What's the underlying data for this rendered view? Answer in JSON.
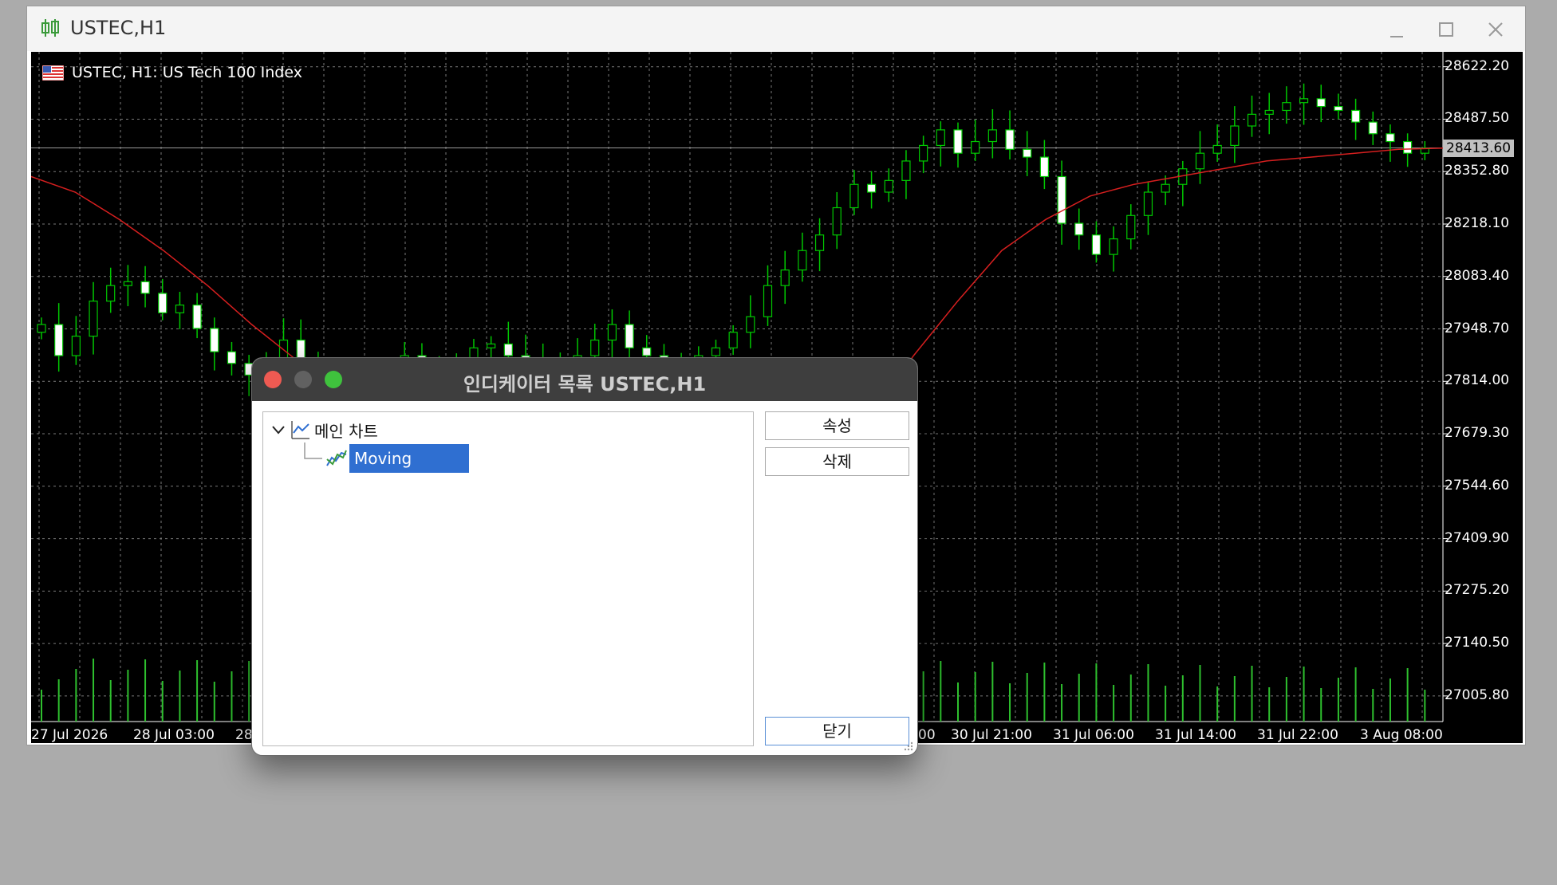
{
  "window": {
    "title": "USTEC,H1",
    "controls": [
      "minimize",
      "maximize",
      "close"
    ]
  },
  "chart": {
    "symbol_label": "USTEC, H1:  US Tech 100 Index",
    "price_axis": [
      "28622.20",
      "28487.50",
      "28352.80",
      "28218.10",
      "28083.40",
      "27948.70",
      "27814.00",
      "27679.30",
      "27544.60",
      "27409.90",
      "27275.20",
      "27140.50",
      "27005.80"
    ],
    "current_price": "28413.60",
    "time_axis": [
      "27 Jul 2026",
      "28 Jul 03:00",
      "28",
      "30 Jul 21:00",
      "31 Jul 06:00",
      "31 Jul 14:00",
      "31 Jul 22:00",
      "3 Aug 08:00"
    ],
    "time_axis_partial": "00",
    "colors": {
      "background": "#000000",
      "candle_up": "#000000",
      "candle_down": "#ffffff",
      "wick": "#00c800",
      "moving_average": "#d61f1f",
      "grid": "#7a7a7a",
      "volume": "#2ec02e"
    }
  },
  "chart_data": {
    "type": "candlestick",
    "xlabel": "",
    "ylabel": "",
    "ylim": [
      26940,
      28640
    ],
    "current_price": 28413.6,
    "series": [
      {
        "visible_closes": [
          27960,
          27880,
          27930,
          28020,
          28060,
          28070,
          28040,
          27990,
          28010,
          27950,
          27890,
          27860,
          27830,
          27870,
          27920,
          27840,
          27770,
          27740,
          27800,
          27790,
          27830,
          27880,
          27850,
          27820,
          27860,
          27900,
          27910,
          27880,
          27860,
          27840,
          27830,
          27880,
          27920,
          27960,
          27900,
          27880,
          27840,
          27860,
          27880,
          27900,
          27940,
          27980,
          28060,
          28100,
          28150,
          28190,
          28260,
          28320,
          28300,
          28330,
          28380,
          28420,
          28460,
          28400,
          28430,
          28460,
          28410,
          28390,
          28340,
          28220,
          28190,
          28140,
          28180,
          28240,
          28300,
          28320,
          28360,
          28400,
          28420,
          28470,
          28500,
          28510,
          28530,
          28540,
          28520,
          28510,
          28480,
          28450,
          28430,
          28400,
          28413
        ]
      },
      {
        "name": "Moving Average",
        "values_sampled": [
          28340,
          28300,
          28230,
          28150,
          28060,
          27960,
          27870,
          27800,
          27780,
          27750,
          27720,
          27660,
          27570,
          27500,
          27420,
          27320,
          27300,
          27420,
          27560,
          27720,
          27880,
          28020,
          28150,
          28230,
          28290,
          28320,
          28340,
          28360,
          28380,
          28390,
          28400,
          28410,
          28413
        ]
      }
    ],
    "volume_note": "vertical green bars along bottom"
  },
  "dialog": {
    "title": "인디케이터 목록 USTEC,H1",
    "tree": {
      "root_label": "메인 차트",
      "children": [
        "Moving Average"
      ]
    },
    "buttons": {
      "properties": "속성",
      "delete": "삭제",
      "close": "닫기"
    }
  }
}
